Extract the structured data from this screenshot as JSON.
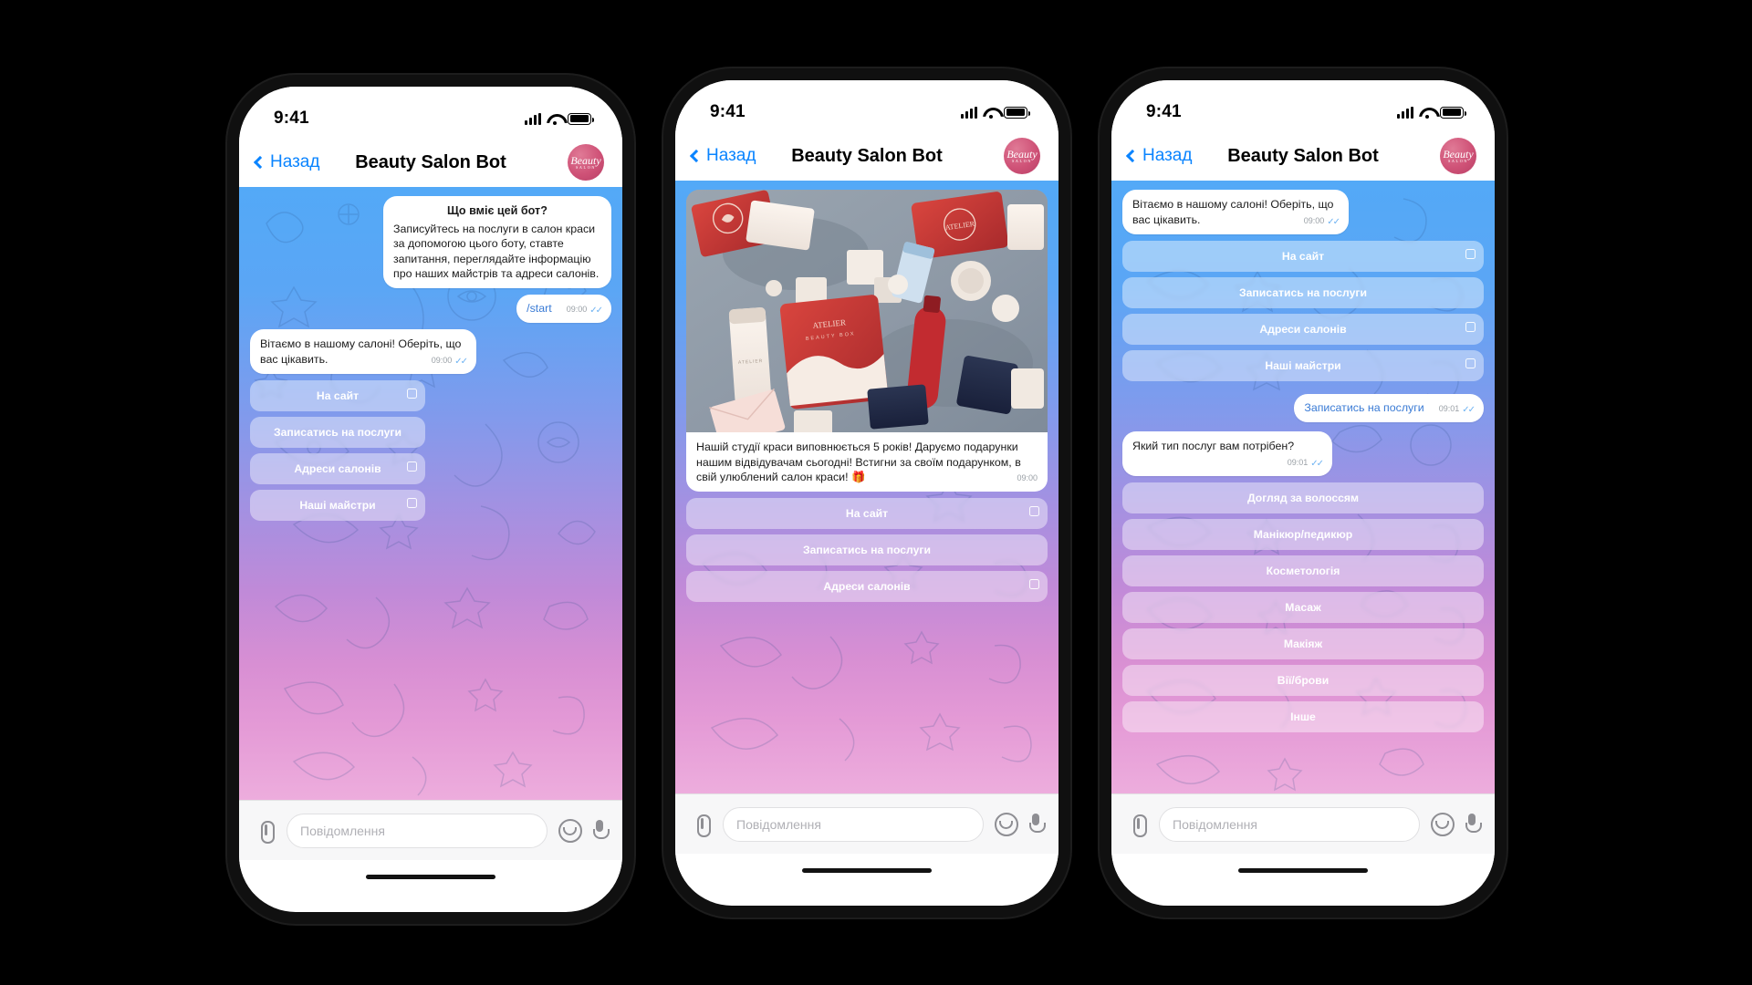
{
  "app": {
    "title": "Beauty Salon Bot",
    "back_label": "Назад",
    "avatar_mark": "Beauty",
    "avatar_sub": "SALON",
    "status_time": "9:41",
    "accent_blue": "#0a84ff",
    "chat_top_color": "#53a9f7",
    "chat_bottom_color": "#edaddd"
  },
  "composer": {
    "placeholder": "Повідомлення",
    "attach_icon": "paperclip-icon",
    "sticker_icon": "sticker-icon",
    "mic_icon": "microphone-icon"
  },
  "phone1": {
    "intro": {
      "title": "Що вміє цей бот?",
      "body": "Записуйтесь на послуги в салон краси за допомогою цього боту, ставте запитання, переглядайте інформацію про наших майстрів та адреси салонів."
    },
    "user_command": {
      "text": "/start",
      "time": "09:00",
      "ticks": "✓✓"
    },
    "welcome": {
      "text": "Вітаємо в нашому салоні! Оберіть, що вас цікавить.",
      "time": "09:00",
      "ticks": "✓✓"
    },
    "buttons": [
      {
        "label": "На сайт",
        "external": true
      },
      {
        "label": "Записатись на послуги",
        "external": false
      },
      {
        "label": "Адреси салонів",
        "external": true
      },
      {
        "label": "Наші майстри",
        "external": true
      }
    ]
  },
  "phone2": {
    "photo_alt": "beauty-products-flatlay-photo",
    "promo": {
      "text": "Нашій студії краси виповнюється 5 років! Даруємо подарунки нашим відвідувачам сьогодні! Встигни за своїм подарунком, в свій улюблений салон краси! 🎁",
      "time": "09:00"
    },
    "buttons": [
      {
        "label": "На сайт",
        "external": true
      },
      {
        "label": "Записатись на послуги",
        "external": false
      },
      {
        "label": "Адреси салонів",
        "external": true
      }
    ]
  },
  "phone3": {
    "welcome": {
      "text": "Вітаємо в нашому салоні! Оберіть, що вас цікавить.",
      "time": "09:00",
      "ticks": "✓✓"
    },
    "menu_buttons": [
      {
        "label": "На сайт",
        "external": true
      },
      {
        "label": "Записатись на послуги",
        "external": false
      },
      {
        "label": "Адреси салонів",
        "external": true
      },
      {
        "label": "Наші майстри",
        "external": true
      }
    ],
    "user_reply": {
      "text": "Записатись на послуги",
      "time": "09:01",
      "ticks": "✓✓"
    },
    "question": {
      "text": "Який тип послуг вам потрібен?",
      "time": "09:01",
      "ticks": "✓✓"
    },
    "service_buttons": [
      {
        "label": "Догляд за волоссям"
      },
      {
        "label": "Манікюр/педикюр"
      },
      {
        "label": "Косметологія"
      },
      {
        "label": "Масаж"
      },
      {
        "label": "Макіяж"
      },
      {
        "label": "Вії/брови"
      },
      {
        "label": "Інше"
      }
    ]
  }
}
